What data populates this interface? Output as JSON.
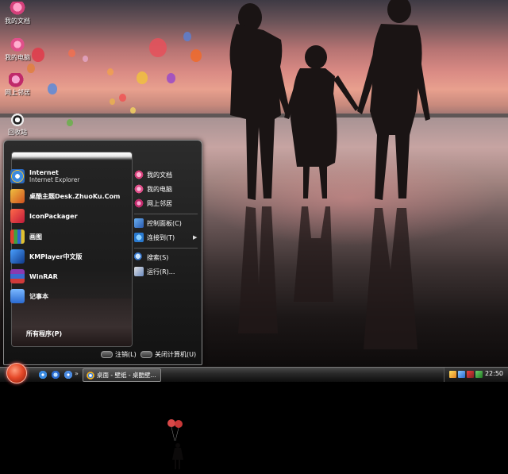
{
  "desktop": {
    "icons": [
      {
        "label": "我的文档",
        "icon": "my-documents-icon"
      },
      {
        "label": "我的电脑",
        "icon": "my-computer-icon"
      },
      {
        "label": "网上邻居",
        "icon": "network-places-icon"
      },
      {
        "label": "回收站",
        "icon": "recycle-bin-icon"
      }
    ]
  },
  "start_menu": {
    "programs": [
      {
        "label": "Internet",
        "sublabel": "Internet Explorer",
        "icon": "internet-explorer-icon"
      },
      {
        "label": "桌酷主题Desk.ZhuoKu.Com",
        "icon": "zhuoku-theme-icon"
      },
      {
        "label": "IconPackager",
        "icon": "iconpackager-icon"
      },
      {
        "label": "画图",
        "icon": "paint-icon"
      },
      {
        "label": "KMPlayer中文版",
        "icon": "kmplayer-icon"
      },
      {
        "label": "WinRAR",
        "icon": "winrar-icon"
      },
      {
        "label": "记事本",
        "icon": "notepad-icon"
      }
    ],
    "all_programs": "所有程序(P)",
    "places": [
      {
        "label": "我的文档",
        "icon": "my-documents-icon"
      },
      {
        "label": "我的电脑",
        "icon": "my-computer-icon"
      },
      {
        "label": "网上邻居",
        "icon": "network-places-icon"
      },
      {
        "label": "控制面板(C)",
        "icon": "control-panel-icon"
      },
      {
        "label": "连接到(T)",
        "icon": "connect-to-icon"
      },
      {
        "label": "搜索(S)",
        "icon": "search-icon"
      },
      {
        "label": "运行(R)...",
        "icon": "run-icon"
      }
    ],
    "logoff": "注销(L)",
    "shutdown": "关闭计算机(U)"
  },
  "taskbar": {
    "task_label": "桌面 - 壁纸 - 桌酷壁...",
    "clock": "22:50"
  },
  "colors": {
    "accent": "#e64a2a",
    "menu_bg": "#1c1c1c",
    "taskbar_bg": "#2a2a2a"
  }
}
